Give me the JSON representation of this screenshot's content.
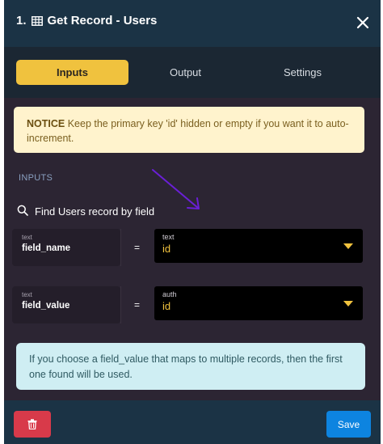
{
  "header": {
    "title": "1. ▦ Get Record - Users",
    "title_number": "1.",
    "title_text": "Get Record - Users",
    "table_icon": "table-icon",
    "close_icon": "close-icon"
  },
  "tabs": [
    {
      "label": "Inputs",
      "active": true
    },
    {
      "label": "Output",
      "active": false
    },
    {
      "label": "Settings",
      "active": false
    }
  ],
  "notice": {
    "strong": "NOTICE",
    "text": " Keep the primary key 'id' hidden or empty if you want it to auto-increment."
  },
  "inputs": {
    "section_label": "INPUTS",
    "find_label": "Find Users record by field",
    "search_icon": "search-icon",
    "rows": [
      {
        "type": "text",
        "name": "field_name",
        "operator": "=",
        "select_type": "text",
        "select_value": "id"
      },
      {
        "type": "text",
        "name": "field_value",
        "operator": "=",
        "select_type": "auth",
        "select_value": "id"
      }
    ]
  },
  "info": {
    "text": "If you choose a field_value that maps to multiple records, then the first one found will be used."
  },
  "footer": {
    "delete_icon": "trash-icon",
    "save_label": "Save"
  },
  "colors": {
    "header_bg": "#1b3345",
    "panel_bg": "#2c2533",
    "accent": "#f0c23e",
    "danger": "#d83a4a",
    "primary": "#0d84e0"
  }
}
